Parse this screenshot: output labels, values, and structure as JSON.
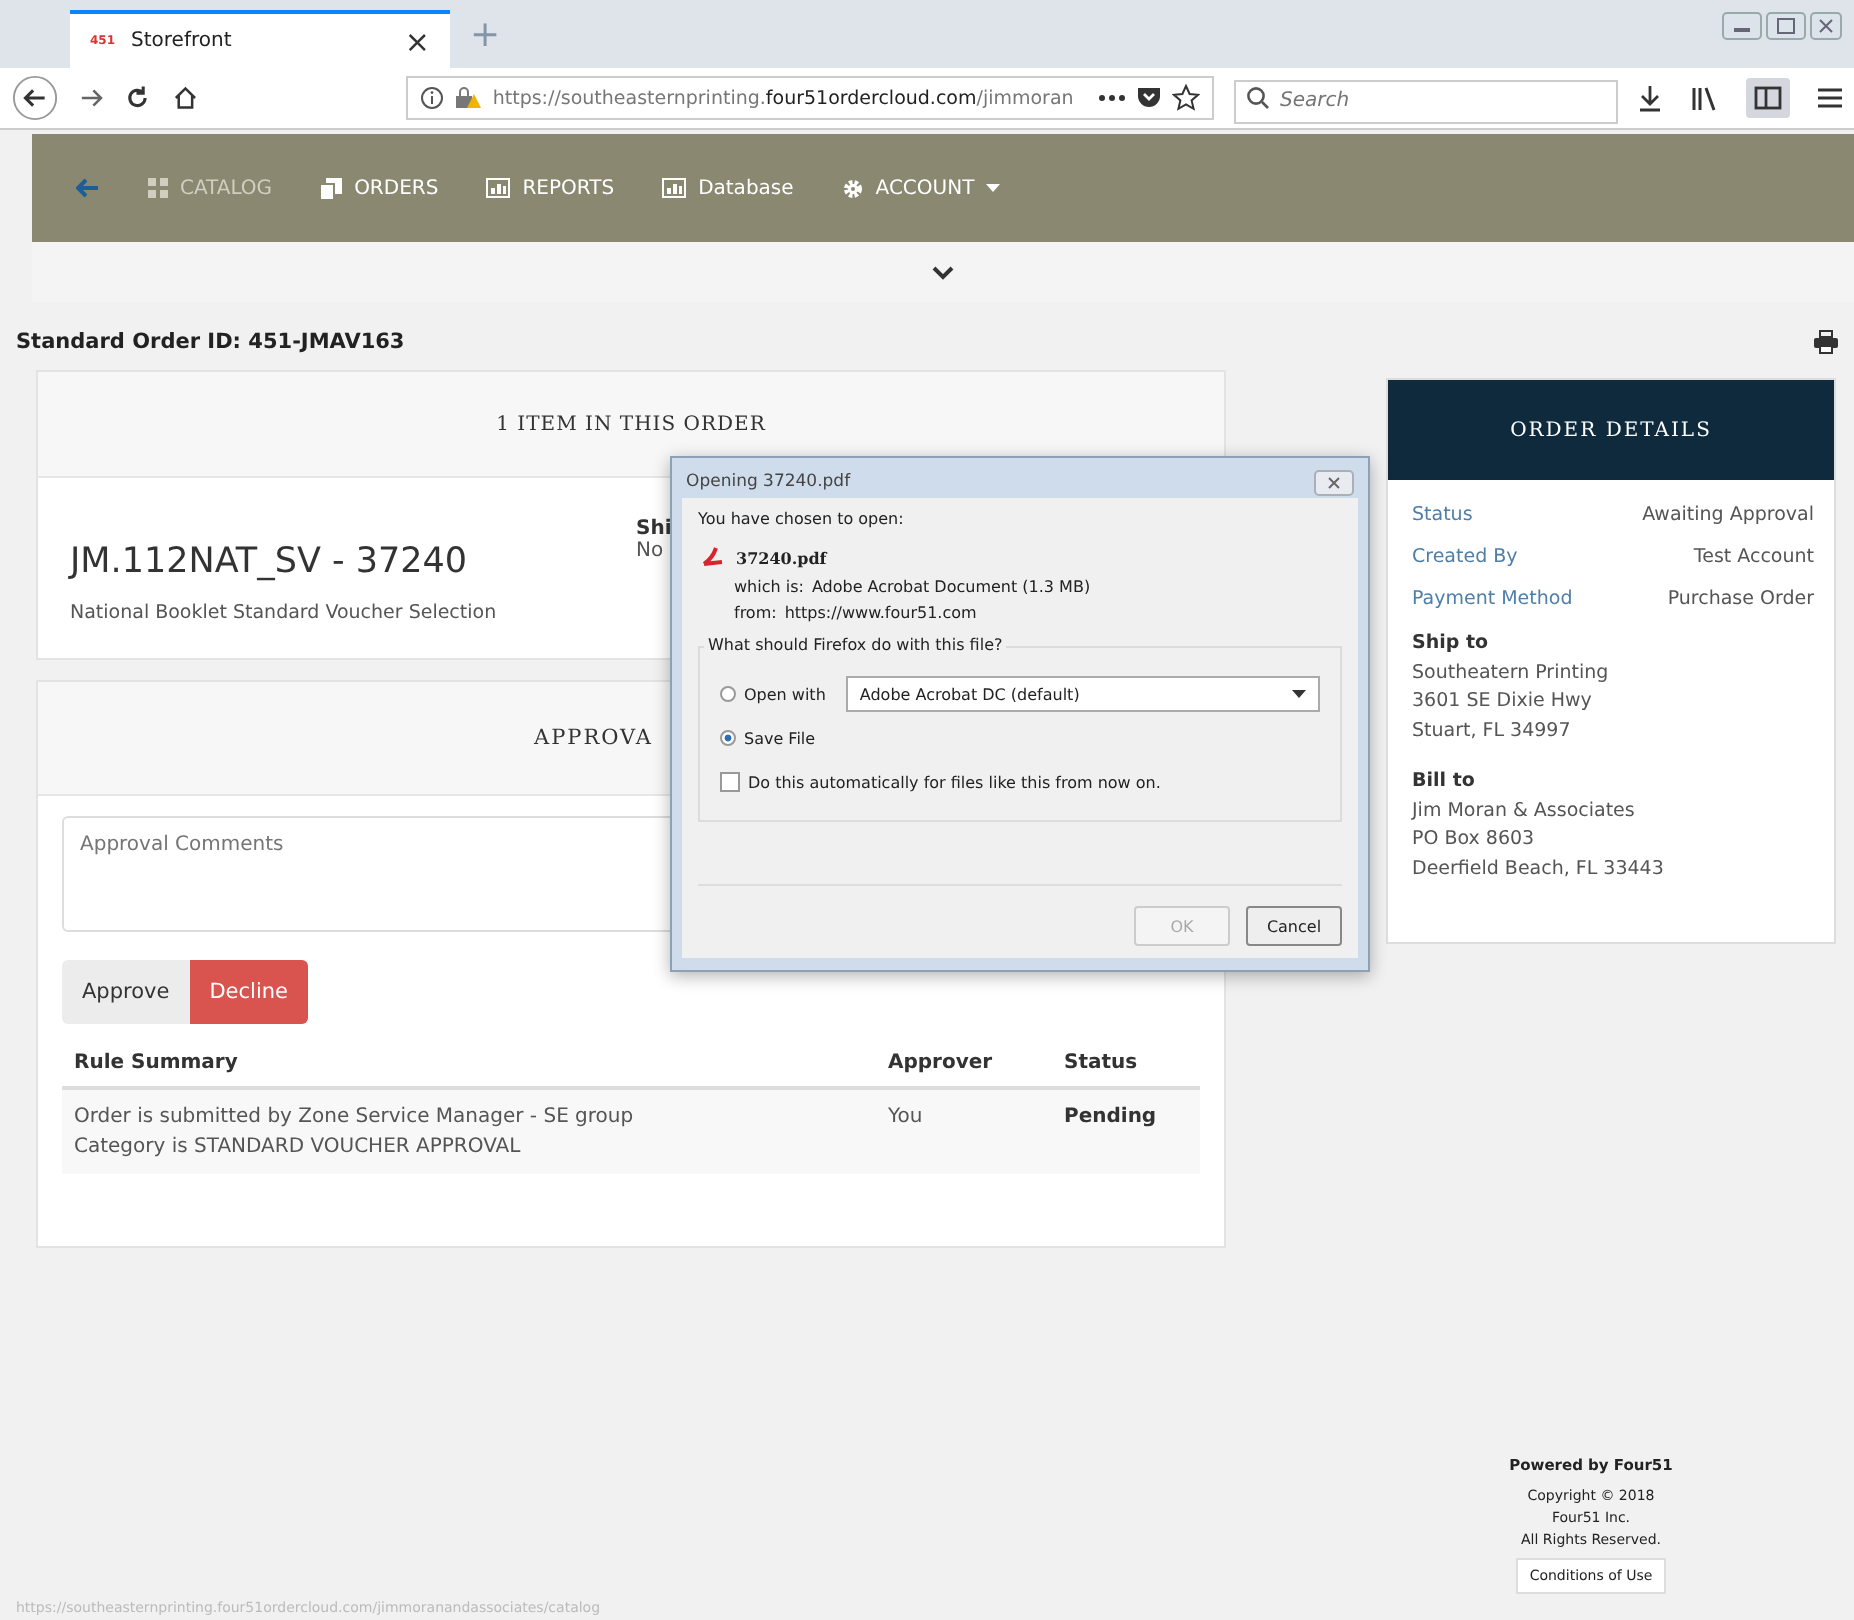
{
  "browser": {
    "tab": {
      "favicon_text": "451",
      "title": "Storefront",
      "close": "×"
    },
    "new_tab": "+",
    "url": {
      "prefix": "https://southeasternprinting.",
      "domain": "four51ordercloud.com",
      "suffix": "/jimmoran"
    },
    "search": {
      "placeholder": "Search"
    }
  },
  "nav": {
    "items": [
      {
        "label": "CATALOG",
        "disabled": true,
        "dropdown": false
      },
      {
        "label": "ORDERS",
        "disabled": false,
        "dropdown": false
      },
      {
        "label": "REPORTS",
        "disabled": false,
        "dropdown": false
      },
      {
        "label": "Database",
        "disabled": false,
        "dropdown": false
      },
      {
        "label": "ACCOUNT",
        "disabled": false,
        "dropdown": true
      }
    ]
  },
  "order_id": "Standard Order ID: 451-JMAV163",
  "item_card": {
    "header": "1 ITEM IN THIS ORDER",
    "title": "JM.112NAT_SV - 37240",
    "description": "National Booklet Standard Voucher Selection",
    "ship_heading": "Shi",
    "ship_value": "No"
  },
  "approval": {
    "header": "APPROVA",
    "placeholder": "Approval Comments",
    "buttons": [
      {
        "label": "Approve",
        "kind": "default"
      },
      {
        "label": "Decline",
        "kind": "danger"
      }
    ],
    "columns": [
      "Rule Summary",
      "Approver",
      "Status"
    ],
    "rows": [
      {
        "rule": [
          "Order is submitted by Zone Service Manager - SE group",
          "Category is STANDARD VOUCHER APPROVAL"
        ],
        "approver": "You",
        "status": "Pending"
      }
    ]
  },
  "order_details": {
    "title": "ORDER DETAILS",
    "fields": [
      {
        "label": "Status",
        "value": "Awaiting Approval"
      },
      {
        "label": "Created By",
        "value": "Test Account"
      },
      {
        "label": "Payment Method",
        "value": "Purchase Order"
      }
    ],
    "addresses": [
      {
        "heading": "Ship to",
        "lines": [
          "Southeatern Printing",
          "3601 SE Dixie Hwy",
          "Stuart, FL 34997"
        ]
      },
      {
        "heading": "Bill to",
        "lines": [
          "Jim Moran & Associates",
          "PO Box 8603",
          "Deerfield Beach, FL 33443"
        ]
      }
    ]
  },
  "footer": {
    "powered": "Powered by Four51",
    "copyright": [
      "Copyright © 2018",
      "Four51 Inc.",
      "All Rights Reserved."
    ],
    "conditions": "Conditions of Use"
  },
  "status_bar": "https://southeasternprinting.four51ordercloud.com/jimmoranandassociates/catalog",
  "dialog": {
    "title": "Opening 37240.pdf",
    "chosen": "You have chosen to open:",
    "file_name": "37240.pdf",
    "which_label": "which is:",
    "which_value": "Adobe Acrobat Document (1.3 MB)",
    "from_label": "from:",
    "from_value": "https://www.four51.com",
    "question": "What should Firefox do with this file?",
    "options": [
      {
        "label": "Open with",
        "selected": false,
        "app": "Adobe Acrobat DC  (default)"
      },
      {
        "label": "Save File",
        "selected": true
      }
    ],
    "auto": {
      "label": "Do this automatically for files like this from now on.",
      "checked": false
    },
    "buttons": [
      {
        "label": "OK",
        "disabled": true
      },
      {
        "label": "Cancel",
        "disabled": false
      }
    ]
  }
}
